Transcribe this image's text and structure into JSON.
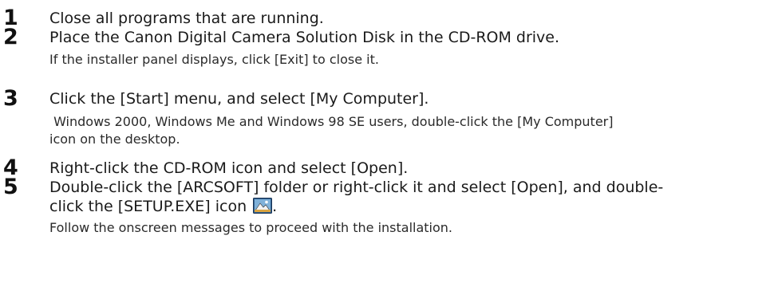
{
  "steps": [
    {
      "number": "1",
      "instruction": "Close all programs that are running."
    },
    {
      "number": "2",
      "instruction": "Place the Canon Digital Camera Solution Disk in the CD-ROM drive.",
      "note": "If the installer panel displays, click [Exit] to close it."
    },
    {
      "number": "3",
      "instruction": "Click the [Start] menu, and select [My Computer].",
      "note_line1": " Windows 2000, Windows Me and Windows 98 SE users, double-click the [My Computer]",
      "note_line2": "icon on the desktop."
    },
    {
      "number": "4",
      "instruction": "Right-click the CD-ROM icon and select [Open]."
    },
    {
      "number": "5",
      "instruction_line1": "Double-click the [ARCSOFT] folder or right-click it and select [Open], and double-",
      "instruction_line2": "click the [SETUP.EXE] icon",
      "instruction_line2_end": ".",
      "icon": "setup-exe-icon",
      "note": "Follow the onscreen messages to proceed with the installation."
    }
  ]
}
